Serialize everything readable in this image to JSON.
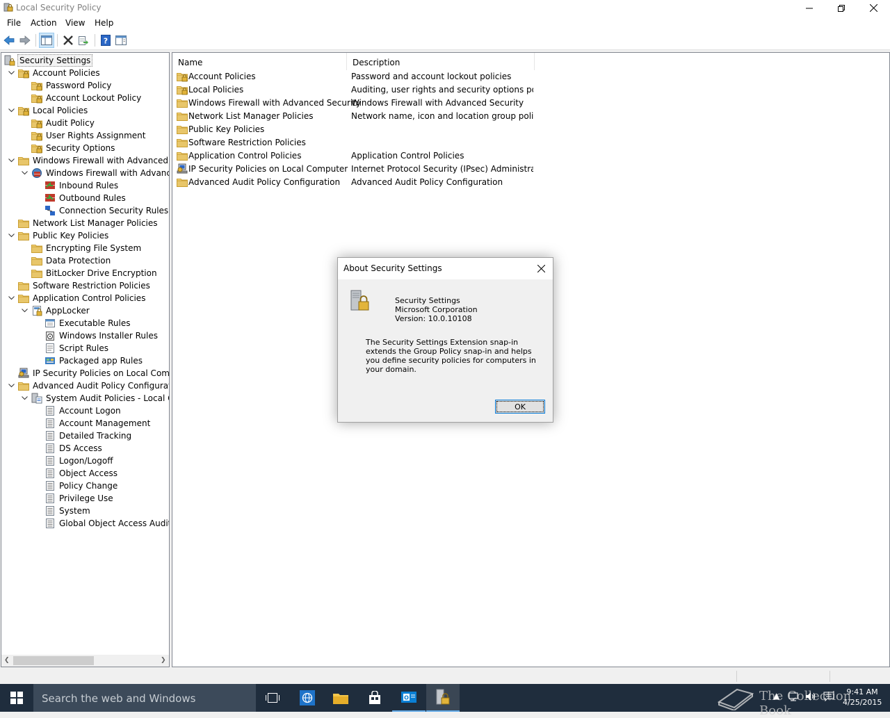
{
  "window": {
    "title": "Local Security Policy"
  },
  "menu": [
    {
      "label": "File"
    },
    {
      "label": "Action"
    },
    {
      "label": "View"
    },
    {
      "label": "Help"
    }
  ],
  "tree": {
    "items": [
      {
        "label": "Security Settings",
        "depth": 0,
        "expander": "none",
        "icon": "security-settings-icon",
        "selected": true
      },
      {
        "label": "Account Policies",
        "depth": 1,
        "expander": "open",
        "icon": "policy-folder-icon"
      },
      {
        "label": "Password Policy",
        "depth": 2,
        "expander": "none",
        "icon": "policy-folder-icon"
      },
      {
        "label": "Account Lockout Policy",
        "depth": 2,
        "expander": "none",
        "icon": "policy-folder-icon"
      },
      {
        "label": "Local Policies",
        "depth": 1,
        "expander": "open",
        "icon": "policy-folder-icon"
      },
      {
        "label": "Audit Policy",
        "depth": 2,
        "expander": "none",
        "icon": "policy-folder-icon"
      },
      {
        "label": "User Rights Assignment",
        "depth": 2,
        "expander": "none",
        "icon": "policy-folder-icon"
      },
      {
        "label": "Security Options",
        "depth": 2,
        "expander": "none",
        "icon": "policy-folder-icon"
      },
      {
        "label": "Windows Firewall with Advanced Secu",
        "depth": 1,
        "expander": "open",
        "icon": "folder-icon"
      },
      {
        "label": "Windows Firewall with Advanced",
        "depth": 2,
        "expander": "open",
        "icon": "firewall-icon"
      },
      {
        "label": "Inbound Rules",
        "depth": 3,
        "expander": "none",
        "icon": "inbound-rules-icon"
      },
      {
        "label": "Outbound Rules",
        "depth": 3,
        "expander": "none",
        "icon": "outbound-rules-icon"
      },
      {
        "label": "Connection Security Rules",
        "depth": 3,
        "expander": "none",
        "icon": "connection-security-icon"
      },
      {
        "label": "Network List Manager Policies",
        "depth": 1,
        "expander": "none",
        "icon": "folder-icon"
      },
      {
        "label": "Public Key Policies",
        "depth": 1,
        "expander": "open",
        "icon": "folder-icon"
      },
      {
        "label": "Encrypting File System",
        "depth": 2,
        "expander": "none",
        "icon": "folder-icon"
      },
      {
        "label": "Data Protection",
        "depth": 2,
        "expander": "none",
        "icon": "folder-icon"
      },
      {
        "label": "BitLocker Drive Encryption",
        "depth": 2,
        "expander": "none",
        "icon": "folder-icon"
      },
      {
        "label": "Software Restriction Policies",
        "depth": 1,
        "expander": "none",
        "icon": "folder-icon"
      },
      {
        "label": "Application Control Policies",
        "depth": 1,
        "expander": "open",
        "icon": "folder-icon"
      },
      {
        "label": "AppLocker",
        "depth": 2,
        "expander": "open",
        "icon": "applocker-icon"
      },
      {
        "label": "Executable Rules",
        "depth": 3,
        "expander": "none",
        "icon": "executable-rules-icon"
      },
      {
        "label": "Windows Installer Rules",
        "depth": 3,
        "expander": "none",
        "icon": "installer-rules-icon"
      },
      {
        "label": "Script Rules",
        "depth": 3,
        "expander": "none",
        "icon": "script-rules-icon"
      },
      {
        "label": "Packaged app Rules",
        "depth": 3,
        "expander": "none",
        "icon": "packaged-app-icon"
      },
      {
        "label": "IP Security Policies on Local Compute",
        "depth": 1,
        "expander": "none",
        "icon": "ipsec-icon"
      },
      {
        "label": "Advanced Audit Policy Configuration",
        "depth": 1,
        "expander": "open",
        "icon": "folder-icon"
      },
      {
        "label": "System Audit Policies - Local Grou",
        "depth": 2,
        "expander": "open",
        "icon": "audit-policies-icon"
      },
      {
        "label": "Account Logon",
        "depth": 3,
        "expander": "none",
        "icon": "audit-category-icon"
      },
      {
        "label": "Account Management",
        "depth": 3,
        "expander": "none",
        "icon": "audit-category-icon"
      },
      {
        "label": "Detailed Tracking",
        "depth": 3,
        "expander": "none",
        "icon": "audit-category-icon"
      },
      {
        "label": "DS Access",
        "depth": 3,
        "expander": "none",
        "icon": "audit-category-icon"
      },
      {
        "label": "Logon/Logoff",
        "depth": 3,
        "expander": "none",
        "icon": "audit-category-icon"
      },
      {
        "label": "Object Access",
        "depth": 3,
        "expander": "none",
        "icon": "audit-category-icon"
      },
      {
        "label": "Policy Change",
        "depth": 3,
        "expander": "none",
        "icon": "audit-category-icon"
      },
      {
        "label": "Privilege Use",
        "depth": 3,
        "expander": "none",
        "icon": "audit-category-icon"
      },
      {
        "label": "System",
        "depth": 3,
        "expander": "none",
        "icon": "audit-category-icon"
      },
      {
        "label": "Global Object Access Auditing",
        "depth": 3,
        "expander": "none",
        "icon": "audit-category-icon"
      }
    ]
  },
  "details": {
    "columns": [
      "Name",
      "Description"
    ],
    "rows": [
      {
        "name": "Account Policies",
        "description": "Password and account lockout policies",
        "icon": "policy-folder-icon"
      },
      {
        "name": "Local Policies",
        "description": "Auditing, user rights and security options polici...",
        "icon": "policy-folder-icon"
      },
      {
        "name": "Windows Firewall with Advanced Security",
        "description": "Windows Firewall with Advanced Security",
        "icon": "folder-icon"
      },
      {
        "name": "Network List Manager Policies",
        "description": "Network name, icon and location group policies.",
        "icon": "folder-icon"
      },
      {
        "name": "Public Key Policies",
        "description": "",
        "icon": "folder-icon"
      },
      {
        "name": "Software Restriction Policies",
        "description": "",
        "icon": "folder-icon"
      },
      {
        "name": "Application Control Policies",
        "description": "Application Control Policies",
        "icon": "folder-icon"
      },
      {
        "name": "IP Security Policies on Local Computer",
        "description": "Internet Protocol Security (IPsec) Administratio...",
        "icon": "ipsec-icon"
      },
      {
        "name": "Advanced Audit Policy Configuration",
        "description": "Advanced Audit Policy Configuration",
        "icon": "folder-icon"
      }
    ]
  },
  "dialog": {
    "title": "About Security Settings",
    "product": "Security Settings",
    "company": "Microsoft Corporation",
    "version": "Version: 10.0.10108",
    "description": "The Security Settings Extension snap-in extends the Group Policy snap-in and helps you define security policies for computers in your domain.",
    "ok_label": "OK"
  },
  "taskbar": {
    "search_placeholder": "Search the web and Windows",
    "watermark": "The Collection Book",
    "time": "9:41 AM",
    "date": "4/25/2015"
  },
  "colors": {
    "folder": "#e8c66a",
    "taskbar": "#1f2d3d",
    "accent": "#0078d7"
  }
}
